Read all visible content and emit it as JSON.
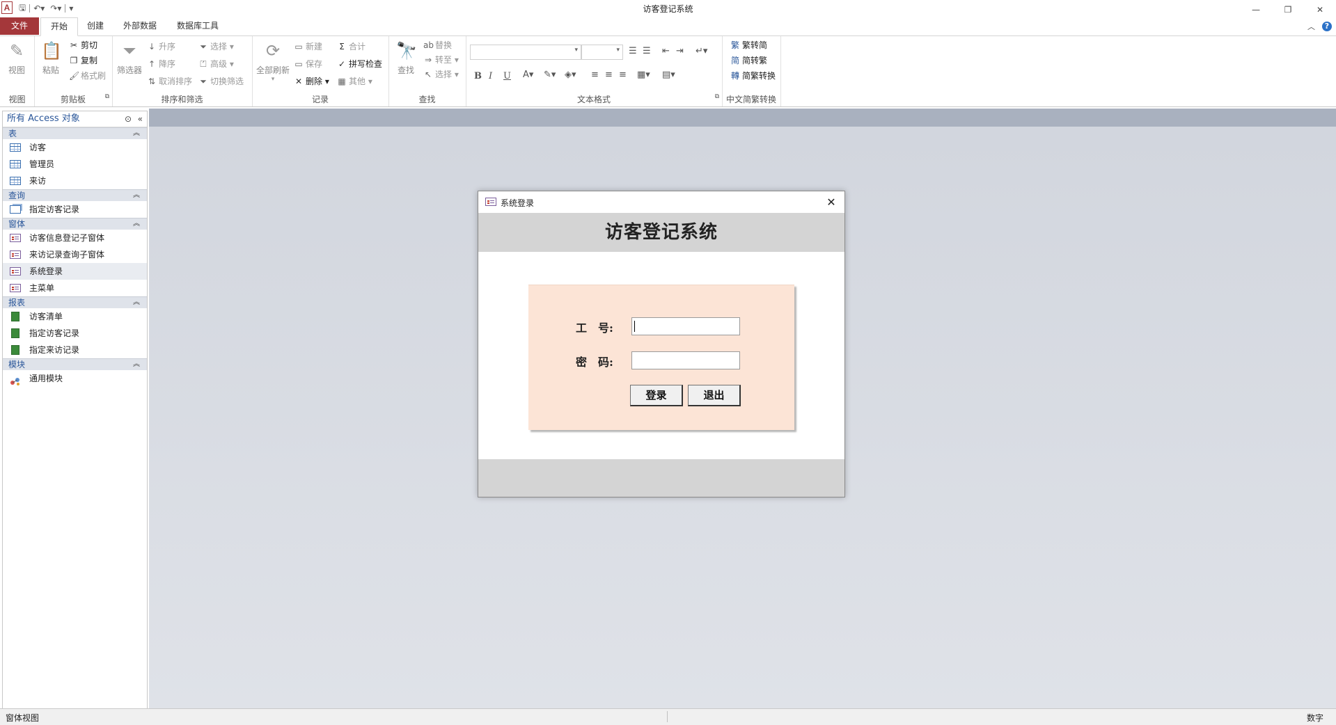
{
  "window": {
    "title": "访客登记系统",
    "app_icon_letter": "A",
    "controls": [
      "minimize-icon",
      "restore-icon",
      "close-icon"
    ]
  },
  "ribbon_tabs": [
    "文件",
    "开始",
    "创建",
    "外部数据",
    "数据库工具"
  ],
  "ribbon": {
    "view": {
      "label": "视图",
      "group": "视图"
    },
    "clipboard": {
      "paste": "粘贴",
      "cut": "剪切",
      "copy": "复制",
      "format_painter": "格式刷",
      "group": "剪贴板"
    },
    "sort_filter": {
      "filter": "筛选器",
      "ascending": "升序",
      "descending": "降序",
      "remove_sort": "取消排序",
      "selection": "选择",
      "advanced": "高级",
      "toggle_filter": "切换筛选",
      "group": "排序和筛选"
    },
    "records": {
      "refresh_all": "全部刷新",
      "new": "新建",
      "save": "保存",
      "delete": "删除",
      "totals": "合计",
      "spelling": "拼写检查",
      "more": "其他",
      "group": "记录"
    },
    "find": {
      "find": "查找",
      "replace": "替换",
      "goto": "转至",
      "select": "选择",
      "group": "查找"
    },
    "text_format": {
      "group": "文本格式",
      "bold": "B",
      "italic": "I",
      "underline": "U"
    },
    "chinese_conversion": {
      "trad_to_simp": "繁转简",
      "simp_to_trad": "简转繁",
      "convert": "简繁转换",
      "group": "中文简繁转换"
    }
  },
  "nav_pane": {
    "title": "所有 Access 对象",
    "sections": [
      {
        "name": "表",
        "items": [
          "访客",
          "管理员",
          "来访"
        ]
      },
      {
        "name": "查询",
        "items": [
          "指定访客记录"
        ]
      },
      {
        "name": "窗体",
        "items": [
          "访客信息登记子窗体",
          "来访记录查询子窗体",
          "系统登录",
          "主菜单"
        ]
      },
      {
        "name": "报表",
        "items": [
          "访客清单",
          "指定访客记录",
          "指定来访记录"
        ]
      },
      {
        "name": "模块",
        "items": [
          "通用模块"
        ]
      }
    ]
  },
  "dialog": {
    "title": "系统登录",
    "heading": "访客登记系统",
    "employee_id_label": "工　号:",
    "password_label": "密　码:",
    "employee_id_value": "",
    "password_value": "",
    "login_button": "登录",
    "exit_button": "退出"
  },
  "status": {
    "left": "窗体视图",
    "right": "数字"
  }
}
